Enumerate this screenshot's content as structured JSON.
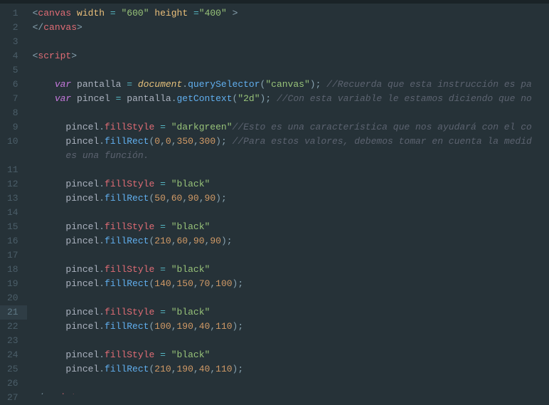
{
  "highlighted_line": 21,
  "lines": [
    {
      "n": 1,
      "tokens": [
        [
          "t-punc",
          "<"
        ],
        [
          "t-tag",
          "canvas"
        ],
        [
          "t-var",
          " "
        ],
        [
          "t-attr",
          "width"
        ],
        [
          "t-var",
          " "
        ],
        [
          "t-op",
          "="
        ],
        [
          "t-var",
          " "
        ],
        [
          "t-str",
          "\"600\""
        ],
        [
          "t-var",
          " "
        ],
        [
          "t-attr",
          "height"
        ],
        [
          "t-var",
          " "
        ],
        [
          "t-op",
          "="
        ],
        [
          "t-str",
          "\"400\""
        ],
        [
          "t-var",
          " "
        ],
        [
          "t-punc",
          ">"
        ]
      ]
    },
    {
      "n": 2,
      "tokens": [
        [
          "t-punc",
          "</"
        ],
        [
          "t-tag",
          "canvas"
        ],
        [
          "t-punc",
          ">"
        ]
      ]
    },
    {
      "n": 3,
      "tokens": []
    },
    {
      "n": 4,
      "tokens": [
        [
          "t-punc",
          "<"
        ],
        [
          "t-tag",
          "script"
        ],
        [
          "t-punc",
          ">"
        ]
      ]
    },
    {
      "n": 5,
      "tokens": []
    },
    {
      "n": 6,
      "tokens": [
        [
          "t-var",
          "    "
        ],
        [
          "t-kw",
          "var"
        ],
        [
          "t-var",
          " pantalla "
        ],
        [
          "t-op",
          "="
        ],
        [
          "t-var",
          " "
        ],
        [
          "t-obj",
          "document"
        ],
        [
          "t-punc",
          "."
        ],
        [
          "t-func",
          "querySelector"
        ],
        [
          "t-punc",
          "("
        ],
        [
          "t-str",
          "\"canvas\""
        ],
        [
          "t-punc",
          "); "
        ],
        [
          "t-cmt",
          "//Recuerda que esta instrucción es pa"
        ]
      ]
    },
    {
      "n": 7,
      "tokens": [
        [
          "t-var",
          "    "
        ],
        [
          "t-kw",
          "var"
        ],
        [
          "t-var",
          " pincel "
        ],
        [
          "t-op",
          "="
        ],
        [
          "t-var",
          " pantalla"
        ],
        [
          "t-punc",
          "."
        ],
        [
          "t-func",
          "getContext"
        ],
        [
          "t-punc",
          "("
        ],
        [
          "t-str",
          "\"2d\""
        ],
        [
          "t-punc",
          "); "
        ],
        [
          "t-cmt",
          "//Con esta variable le estamos diciendo que no"
        ]
      ]
    },
    {
      "n": 8,
      "tokens": []
    },
    {
      "n": 9,
      "tokens": [
        [
          "t-var",
          "      pincel"
        ],
        [
          "t-punc",
          "."
        ],
        [
          "t-prop",
          "fillStyle"
        ],
        [
          "t-var",
          " "
        ],
        [
          "t-op",
          "="
        ],
        [
          "t-var",
          " "
        ],
        [
          "t-str",
          "\"darkgreen\""
        ],
        [
          "t-cmt",
          "//Esto es una característica que nos ayudará con el co"
        ]
      ]
    },
    {
      "n": 10,
      "tokens": [
        [
          "t-var",
          "      pincel"
        ],
        [
          "t-punc",
          "."
        ],
        [
          "t-func",
          "fillRect"
        ],
        [
          "t-punc",
          "("
        ],
        [
          "t-num",
          "0"
        ],
        [
          "t-punc",
          ","
        ],
        [
          "t-num",
          "0"
        ],
        [
          "t-punc",
          ","
        ],
        [
          "t-num",
          "350"
        ],
        [
          "t-punc",
          ","
        ],
        [
          "t-num",
          "300"
        ],
        [
          "t-punc",
          "); "
        ],
        [
          "t-cmt",
          "//Para estos valores, debemos tomar en cuenta la medid      es una función."
        ]
      ]
    },
    {
      "n": 11,
      "tokens": []
    },
    {
      "n": 12,
      "tokens": [
        [
          "t-var",
          "      pincel"
        ],
        [
          "t-punc",
          "."
        ],
        [
          "t-prop",
          "fillStyle"
        ],
        [
          "t-var",
          " "
        ],
        [
          "t-op",
          "="
        ],
        [
          "t-var",
          " "
        ],
        [
          "t-str",
          "\"black\""
        ]
      ]
    },
    {
      "n": 13,
      "tokens": [
        [
          "t-var",
          "      pincel"
        ],
        [
          "t-punc",
          "."
        ],
        [
          "t-func",
          "fillRect"
        ],
        [
          "t-punc",
          "("
        ],
        [
          "t-num",
          "50"
        ],
        [
          "t-punc",
          ","
        ],
        [
          "t-num",
          "60"
        ],
        [
          "t-punc",
          ","
        ],
        [
          "t-num",
          "90"
        ],
        [
          "t-punc",
          ","
        ],
        [
          "t-num",
          "90"
        ],
        [
          "t-punc",
          ");"
        ]
      ]
    },
    {
      "n": 14,
      "tokens": []
    },
    {
      "n": 15,
      "tokens": [
        [
          "t-var",
          "      pincel"
        ],
        [
          "t-punc",
          "."
        ],
        [
          "t-prop",
          "fillStyle"
        ],
        [
          "t-var",
          " "
        ],
        [
          "t-op",
          "="
        ],
        [
          "t-var",
          " "
        ],
        [
          "t-str",
          "\"black\""
        ]
      ]
    },
    {
      "n": 16,
      "tokens": [
        [
          "t-var",
          "      pincel"
        ],
        [
          "t-punc",
          "."
        ],
        [
          "t-func",
          "fillRect"
        ],
        [
          "t-punc",
          "("
        ],
        [
          "t-num",
          "210"
        ],
        [
          "t-punc",
          ","
        ],
        [
          "t-num",
          "60"
        ],
        [
          "t-punc",
          ","
        ],
        [
          "t-num",
          "90"
        ],
        [
          "t-punc",
          ","
        ],
        [
          "t-num",
          "90"
        ],
        [
          "t-punc",
          ");"
        ]
      ]
    },
    {
      "n": 17,
      "tokens": []
    },
    {
      "n": 18,
      "tokens": [
        [
          "t-var",
          "      pincel"
        ],
        [
          "t-punc",
          "."
        ],
        [
          "t-prop",
          "fillStyle"
        ],
        [
          "t-var",
          " "
        ],
        [
          "t-op",
          "="
        ],
        [
          "t-var",
          " "
        ],
        [
          "t-str",
          "\"black\""
        ]
      ]
    },
    {
      "n": 19,
      "tokens": [
        [
          "t-var",
          "      pincel"
        ],
        [
          "t-punc",
          "."
        ],
        [
          "t-func",
          "fillRect"
        ],
        [
          "t-punc",
          "("
        ],
        [
          "t-num",
          "140"
        ],
        [
          "t-punc",
          ","
        ],
        [
          "t-num",
          "150"
        ],
        [
          "t-punc",
          ","
        ],
        [
          "t-num",
          "70"
        ],
        [
          "t-punc",
          ","
        ],
        [
          "t-num",
          "100"
        ],
        [
          "t-punc",
          ");"
        ]
      ]
    },
    {
      "n": 20,
      "tokens": []
    },
    {
      "n": 21,
      "tokens": [
        [
          "t-var",
          "      pincel"
        ],
        [
          "t-punc",
          "."
        ],
        [
          "t-prop",
          "fillStyle"
        ],
        [
          "t-var",
          " "
        ],
        [
          "t-op",
          "="
        ],
        [
          "t-var",
          " "
        ],
        [
          "t-str",
          "\"black\""
        ]
      ]
    },
    {
      "n": 22,
      "tokens": [
        [
          "t-var",
          "      pincel"
        ],
        [
          "t-punc",
          "."
        ],
        [
          "t-func",
          "fillRect"
        ],
        [
          "t-punc",
          "("
        ],
        [
          "t-num",
          "100"
        ],
        [
          "t-punc",
          ","
        ],
        [
          "t-num",
          "190"
        ],
        [
          "t-punc",
          ","
        ],
        [
          "t-num",
          "40"
        ],
        [
          "t-punc",
          ","
        ],
        [
          "t-num",
          "110"
        ],
        [
          "t-punc",
          ");"
        ]
      ]
    },
    {
      "n": 23,
      "tokens": []
    },
    {
      "n": 24,
      "tokens": [
        [
          "t-var",
          "      pincel"
        ],
        [
          "t-punc",
          "."
        ],
        [
          "t-prop",
          "fillStyle"
        ],
        [
          "t-var",
          " "
        ],
        [
          "t-op",
          "="
        ],
        [
          "t-var",
          " "
        ],
        [
          "t-str",
          "\"black\""
        ]
      ]
    },
    {
      "n": 25,
      "tokens": [
        [
          "t-var",
          "      pincel"
        ],
        [
          "t-punc",
          "."
        ],
        [
          "t-func",
          "fillRect"
        ],
        [
          "t-punc",
          "("
        ],
        [
          "t-num",
          "210"
        ],
        [
          "t-punc",
          ","
        ],
        [
          "t-num",
          "190"
        ],
        [
          "t-punc",
          ","
        ],
        [
          "t-num",
          "40"
        ],
        [
          "t-punc",
          ","
        ],
        [
          "t-num",
          "110"
        ],
        [
          "t-punc",
          ");"
        ]
      ]
    },
    {
      "n": 26,
      "tokens": []
    },
    {
      "n": 27,
      "tokens": [
        [
          "t-punc",
          "</"
        ],
        [
          "t-tag",
          "script"
        ],
        [
          "t-punc",
          ">"
        ]
      ]
    }
  ]
}
